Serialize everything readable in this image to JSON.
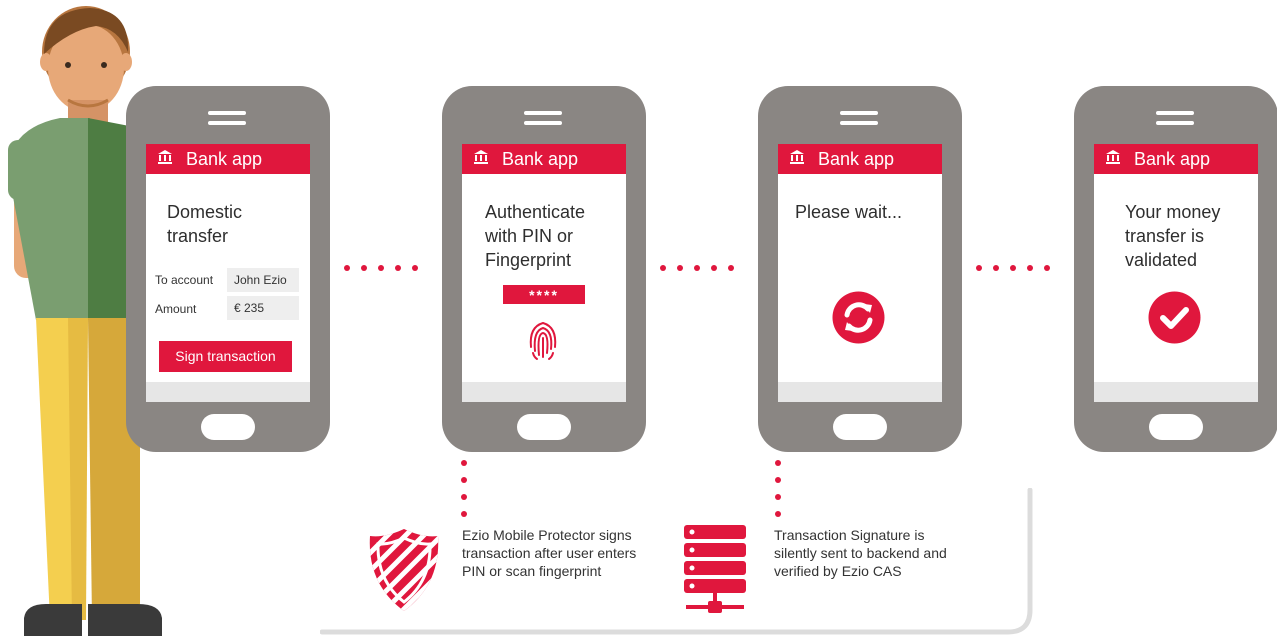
{
  "app_title": "Bank app",
  "phone1": {
    "heading": "Domestic transfer",
    "to_account_label": "To account",
    "to_account_value": "John Ezio",
    "amount_label": "Amount",
    "amount_value": "€ 235",
    "sign_button": "Sign transaction"
  },
  "phone2": {
    "message": "Authenticate with PIN or Fingerprint",
    "pin_mask": "****"
  },
  "phone3": {
    "message": "Please wait..."
  },
  "phone4": {
    "message": "Your money transfer is validated"
  },
  "notes": {
    "protector": "Ezio Mobile Protector signs transaction after user enters PIN or scan fingerprint",
    "backend": "Transaction Signature is silently sent to backend and verified by Ezio CAS"
  },
  "colors": {
    "accent": "#e0173d",
    "phone_body": "#8a8683",
    "field_bg": "#eeeeee"
  },
  "icons": [
    "bank-icon",
    "fingerprint-icon",
    "refresh-icon",
    "checkmark-icon",
    "shield-icon",
    "server-icon"
  ]
}
